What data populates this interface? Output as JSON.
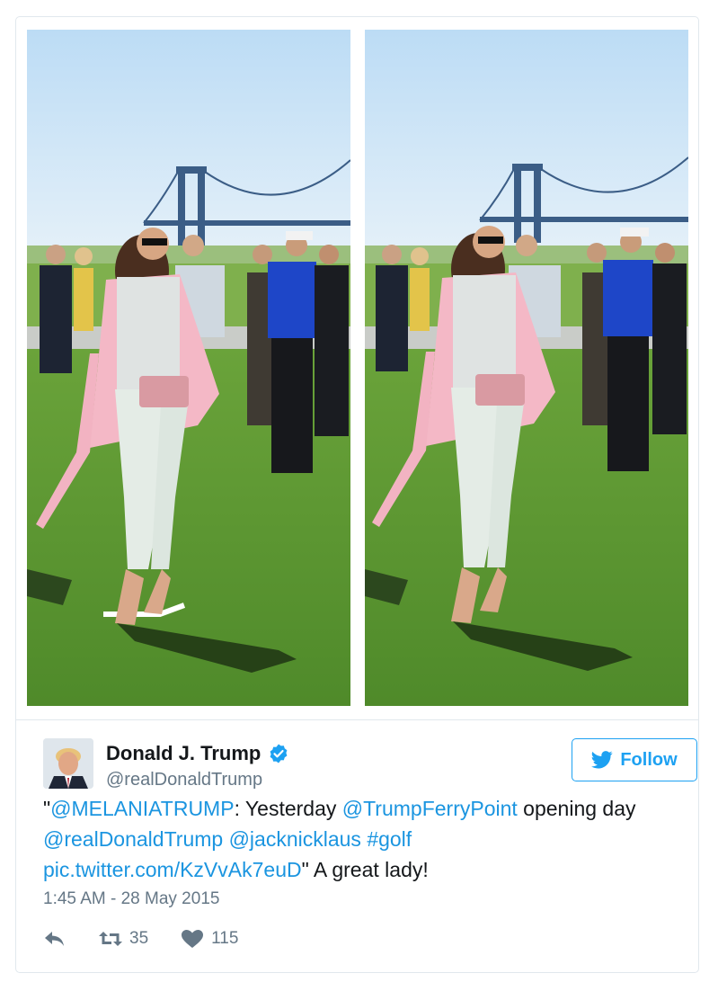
{
  "tweet": {
    "display_name": "Donald J. Trump",
    "screen_name": "@realDonaldTrump",
    "follow_label": "Follow",
    "text": {
      "quote_open": "\"",
      "mention_melania": "@MELANIATRUMP",
      "part1": ": Yesterday ",
      "mention_ferry": "@TrumpFerryPoint",
      "part2": " opening day ",
      "mention_trump": "@realDonaldTrump",
      "space1": " ",
      "mention_jack": "@jacknicklaus",
      "space2": " ",
      "hashtag": "#golf",
      "link": "pic.twitter.com/KzVvAk7euD",
      "part3": "\" A great lady!"
    },
    "timestamp": "1:45 AM - 28 May 2015",
    "retweets": "35",
    "likes": "115"
  },
  "icons": {
    "verified": "verified-badge-icon",
    "bird": "twitter-bird-icon",
    "reply": "reply-icon",
    "retweet": "retweet-icon",
    "like": "heart-icon"
  },
  "colors": {
    "accent": "#1da1f2",
    "link": "#1b95e0",
    "muted": "#657786",
    "border": "#e1e8ed"
  }
}
